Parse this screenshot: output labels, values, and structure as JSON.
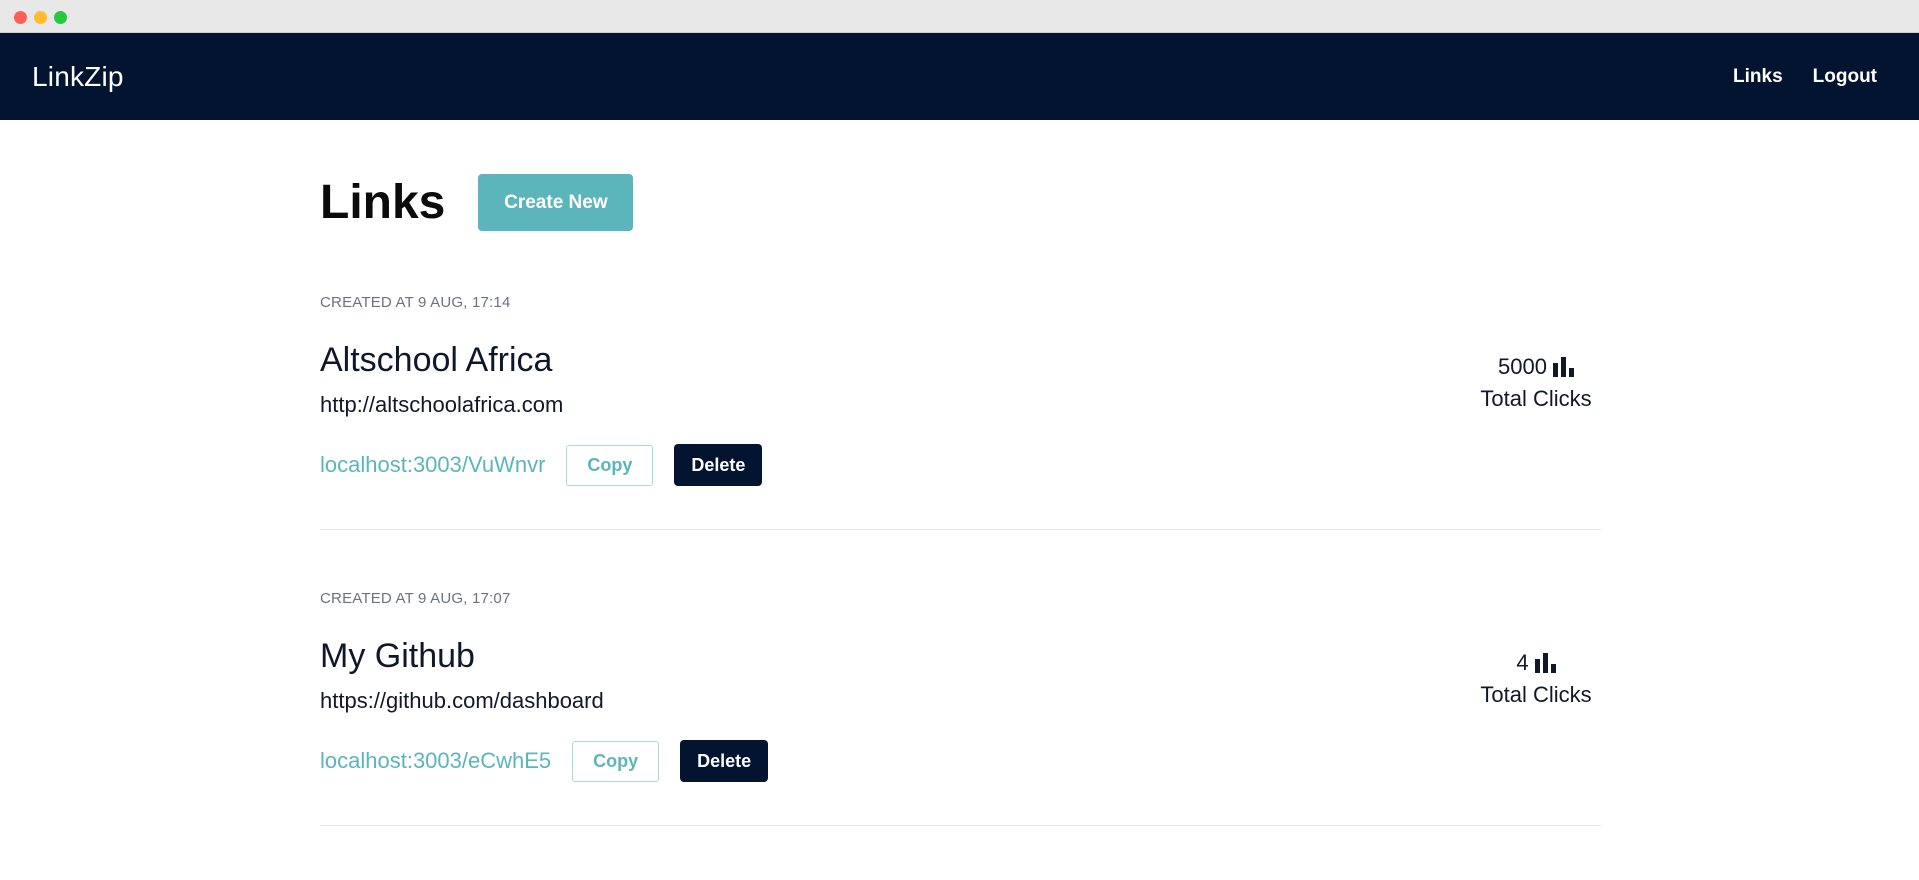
{
  "navbar": {
    "brand": "LinkZip",
    "links": [
      "Links",
      "Logout"
    ]
  },
  "page": {
    "title": "Links",
    "create_button": "Create New"
  },
  "links": [
    {
      "created": "CREATED AT 9 AUG, 17:14",
      "title": "Altschool Africa",
      "url": "http://altschoolafrica.com",
      "short_url": "localhost:3003/VuWnvr",
      "copy_label": "Copy",
      "delete_label": "Delete",
      "clicks": "5000",
      "clicks_label": "Total Clicks",
      "stats_icon": "bar-chart-icon"
    },
    {
      "created": "CREATED AT 9 AUG, 17:07",
      "title": "My Github",
      "url": "https://github.com/dashboard",
      "short_url": "localhost:3003/eCwhE5",
      "copy_label": "Copy",
      "delete_label": "Delete",
      "clicks": "4",
      "clicks_label": "Total Clicks",
      "stats_icon": "bar-chart-icon"
    }
  ],
  "colors": {
    "navbar": "#031430",
    "accent": "#5bb5bb",
    "delete": "#031430"
  }
}
